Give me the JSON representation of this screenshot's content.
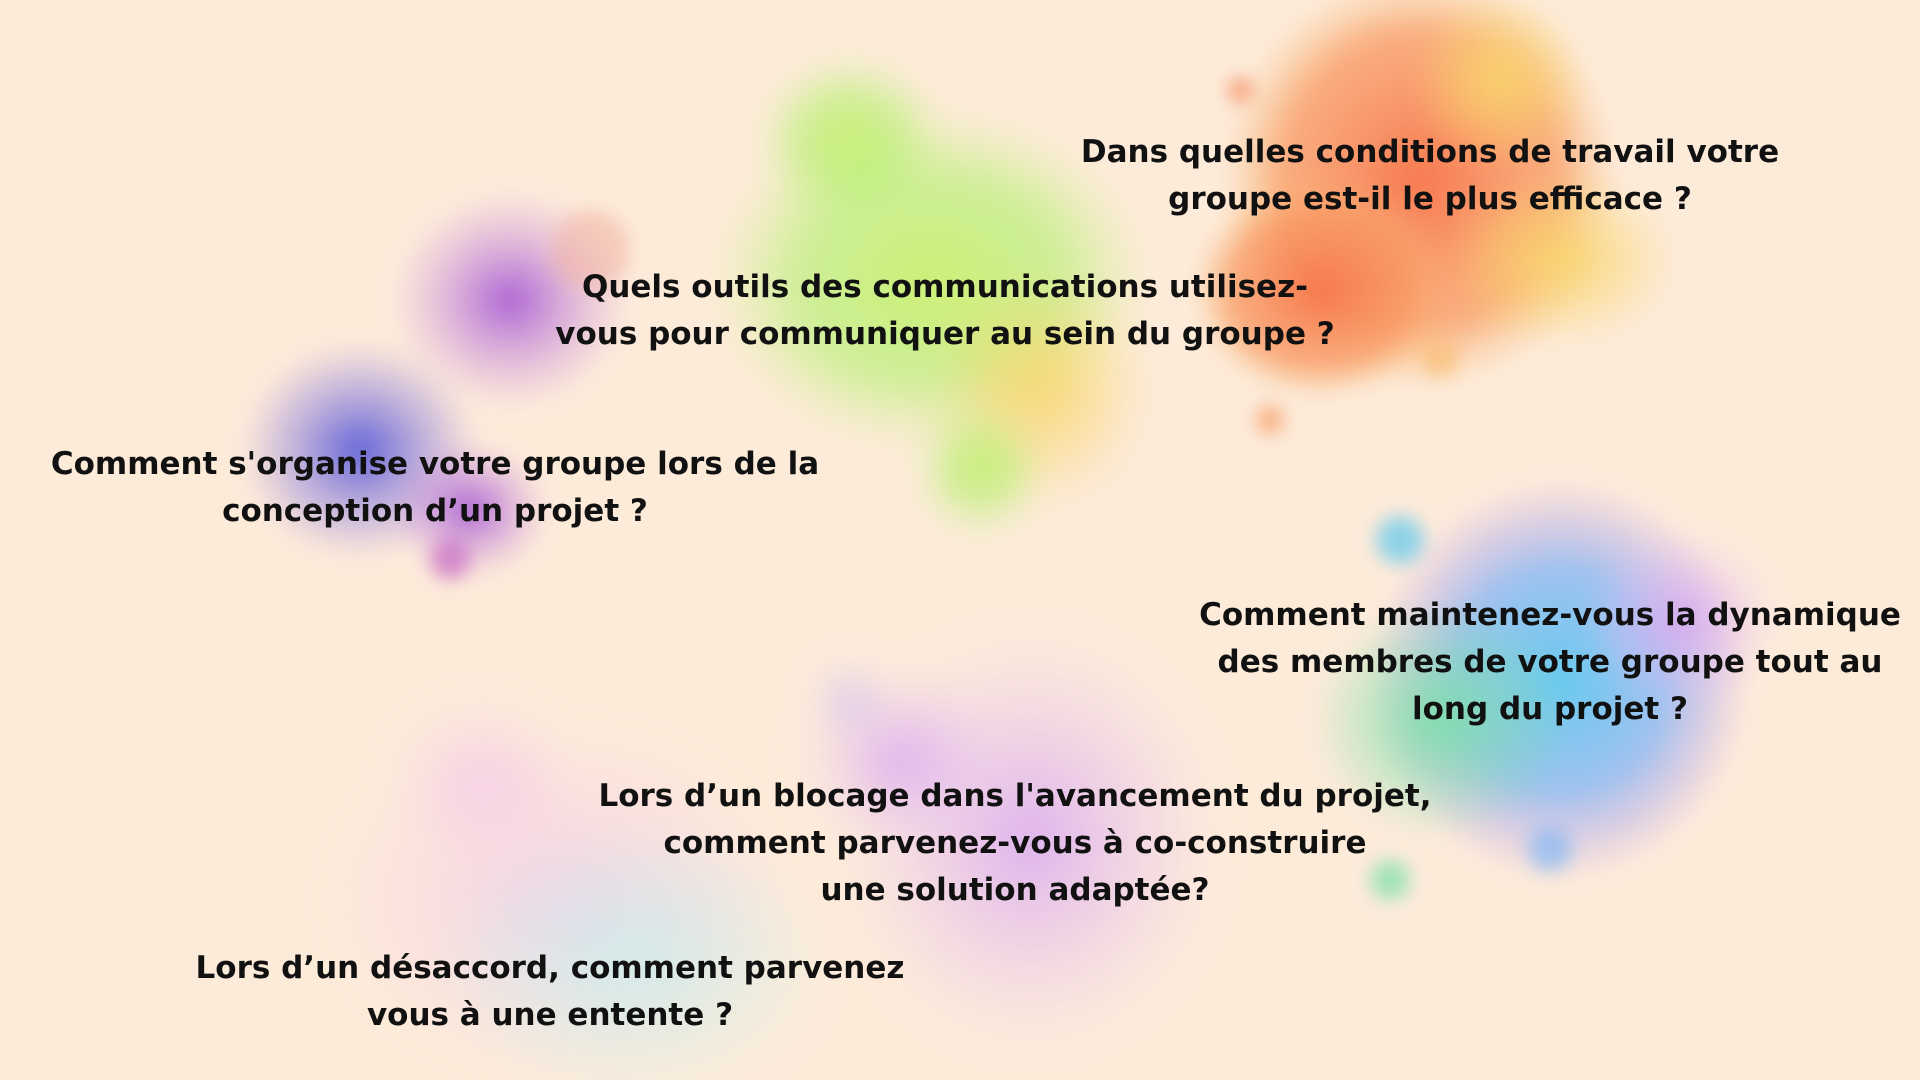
{
  "colors": {
    "background": "#fdebda",
    "text": "#111111",
    "splash_orange": "#f7744a",
    "splash_yellow": "#f9d56b",
    "splash_green": "#c8f06a",
    "splash_purple": "#b46ad8",
    "splash_blue": "#6a7de0",
    "splash_cyan": "#5fc8f0",
    "splash_mint": "#7be0a8",
    "splash_lilac": "#d7a6f0",
    "splash_pink": "#f3c6ea"
  },
  "questions": [
    {
      "id": "q1",
      "lines": [
        "Dans quelles conditions de travail votre",
        "groupe est-il le plus efficace ?"
      ]
    },
    {
      "id": "q2",
      "lines": [
        "Quels outils des communications utilisez-",
        "vous pour communiquer au sein du groupe ?"
      ]
    },
    {
      "id": "q3",
      "lines": [
        "Comment s'organise votre groupe lors de la",
        "conception d’un projet ?"
      ]
    },
    {
      "id": "q4",
      "lines": [
        "Comment maintenez-vous la dynamique",
        "des membres de votre groupe tout au",
        "long du projet ?"
      ]
    },
    {
      "id": "q5",
      "lines": [
        "Lors d’un blocage dans l'avancement du projet,",
        "comment parvenez-vous à co-construire",
        "une solution adaptée?"
      ]
    },
    {
      "id": "q6",
      "lines": [
        "Lors d’un désaccord, comment parvenez",
        "vous à une entente ?"
      ]
    }
  ]
}
